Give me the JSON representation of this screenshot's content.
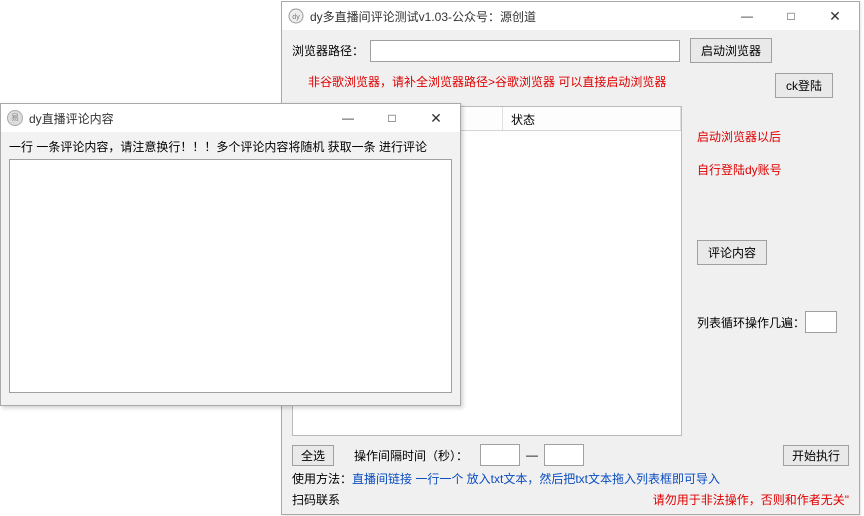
{
  "main": {
    "title": "dy多直播间评论测试v1.03-公众号：源创道",
    "browser_path_label": "浏览器路径：",
    "browser_path_value": "",
    "start_browser_btn": "启动浏览器",
    "non_chrome_hint": "非谷歌浏览器，请补全浏览器路径>谷歌浏览器 可以直接启动浏览器",
    "ck_login_btn": "ck登陆",
    "table": {
      "col_checkbox": "",
      "col_status": "状态"
    },
    "right": {
      "hint1": "启动浏览器以后",
      "hint2": "自行登陆dy账号",
      "comment_content_btn": "评论内容",
      "loop_label": "列表循环操作几遍：",
      "loop_value": ""
    },
    "bottom": {
      "select_all_btn": "全选",
      "interval_label": "操作间隔时间（秒）：",
      "interval_from": "",
      "interval_to": "",
      "start_btn": "开始执行",
      "usage_label": "使用方法：",
      "usage_text": "直播间链接 一行一个 放入txt文本，然后把txt文本拖入列表框即可导入",
      "scan_label": "扫码联系",
      "disclaimer": "请勿用于非法操作，否则和作者无关\""
    }
  },
  "popup": {
    "title": "dy直播评论内容",
    "hint": "一行 一条评论内容，请注意换行！！！多个评论内容将随机 获取一条 进行评论",
    "textarea_value": ""
  },
  "wincontrols": {
    "minimize": "—",
    "maximize": "□",
    "close": "✕"
  }
}
